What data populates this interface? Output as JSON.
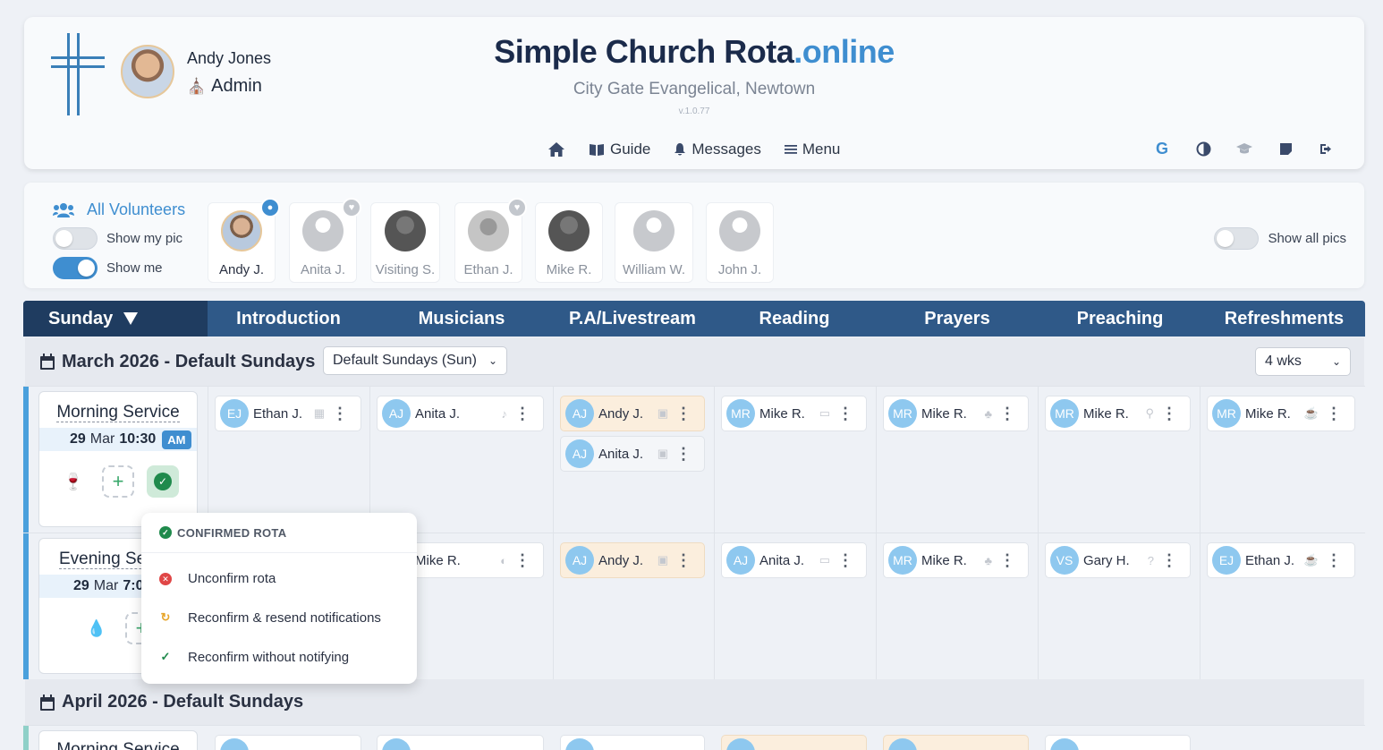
{
  "header": {
    "user_name": "Andy Jones",
    "user_role": "Admin",
    "title_main": "Simple Church Rota",
    "title_accent": ".online",
    "church": "City Gate Evangelical, Newtown",
    "version": "v.1.0.77",
    "nav": {
      "guide": "Guide",
      "messages": "Messages",
      "menu": "Menu"
    },
    "tools": [
      "google-icon",
      "contrast-icon",
      "graduation-cap-icon",
      "note-icon",
      "logout-icon"
    ]
  },
  "volunteers": {
    "all_label": "All Volunteers",
    "show_my_pic": "Show my pic",
    "show_me": "Show me",
    "show_all_pics": "Show all pics",
    "people": [
      {
        "name": "Andy J."
      },
      {
        "name": "Anita J."
      },
      {
        "name": "Visiting S."
      },
      {
        "name": "Ethan J."
      },
      {
        "name": "Mike R."
      },
      {
        "name": "William W."
      },
      {
        "name": "John J."
      }
    ]
  },
  "roles": {
    "day": "Sunday",
    "columns": [
      "Introduction",
      "Musicians",
      "P.A/Livestream",
      "Reading",
      "Prayers",
      "Preaching",
      "Refreshments"
    ]
  },
  "march": {
    "title": "March 2026 - Default Sundays",
    "template_select": "Default Sundays (Sun)",
    "weeks_select": "4 wks"
  },
  "morning": {
    "name": "Morning Service",
    "day": "29",
    "month": "Mar",
    "time": "10:30",
    "ampm": "AM",
    "chips": [
      {
        "initials": "AJ",
        "name": "Andy J."
      },
      {
        "initials": "AJ",
        "name": "Anita J."
      },
      {
        "initials": "EJ",
        "name": "Ethan J."
      },
      {
        "initials": "MR",
        "name": "Mike R."
      }
    ]
  },
  "evening": {
    "name": "Evening Service",
    "day": "29",
    "month": "Mar",
    "time": "7:0",
    "chips": [
      {
        "initials": "MR",
        "name": "Mike R."
      },
      {
        "initials": "AJ",
        "name": "Andy J."
      },
      {
        "initials": "AJ",
        "name": "Anita J."
      },
      {
        "initials": "MR",
        "name": "Mike R."
      },
      {
        "initials": "VS",
        "name": "Gary H."
      },
      {
        "initials": "EJ",
        "name": "Ethan J."
      }
    ]
  },
  "april": {
    "title": "April 2026 - Default Sundays",
    "next_service": "Morning Service"
  },
  "popup": {
    "header": "CONFIRMED ROTA",
    "items": [
      "Unconfirm rota",
      "Reconfirm & resend notifications",
      "Reconfirm without notifying"
    ]
  },
  "colors": {
    "accent": "#3f8ed0",
    "role_bar": "#2f5988",
    "day_cell": "#1f3c60",
    "confirmed": "#1f8a4c",
    "warm_chip": "#fbeedd"
  }
}
